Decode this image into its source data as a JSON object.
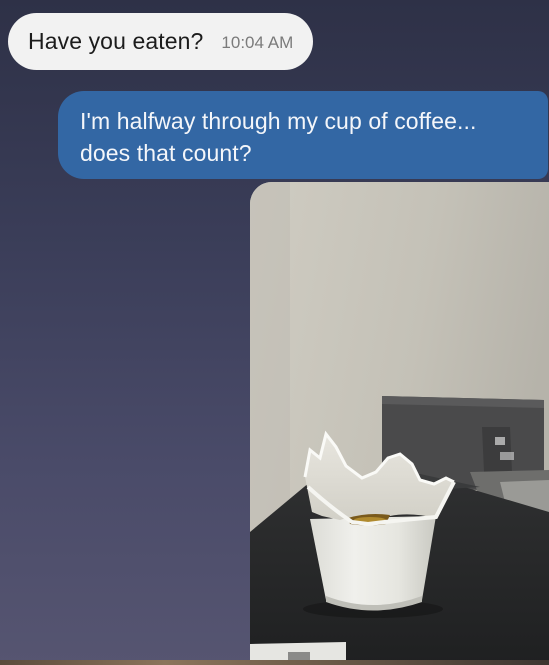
{
  "conversation": {
    "incoming": {
      "text": "Have you eaten?",
      "time": "10:04 AM"
    },
    "outgoing": {
      "text": "I'm halfway through my cup of coffee... does that count?"
    },
    "photo": {
      "subject": "broken white cup with coffee"
    }
  },
  "colors": {
    "background": "#3a3d58",
    "incoming_bubble": "#f2f2f2",
    "outgoing_bubble": "#3367a4"
  }
}
